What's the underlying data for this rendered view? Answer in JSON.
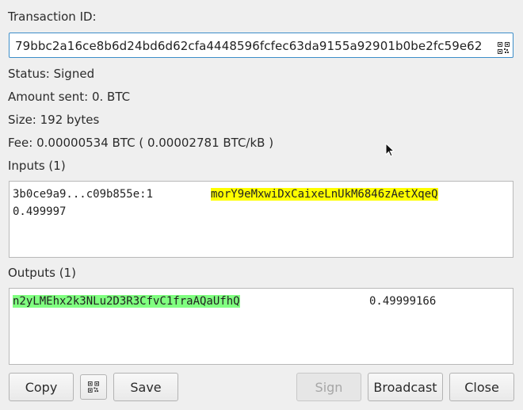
{
  "transaction": {
    "id_label": "Transaction ID:",
    "id_value": "79bbc2a16ce8b6d24bd6d62cfa4448596fcfec63da9155a92901b0be2fc59e62"
  },
  "details": {
    "status": "Status: Signed",
    "amount": "Amount sent: 0. BTC",
    "size": "Size: 192 bytes",
    "fee": "Fee: 0.00000534 BTC  ( 0.00002781 BTC/kB )"
  },
  "inputs": {
    "label": "Inputs (1)",
    "items": [
      {
        "outpoint": "3b0ce9a9...c09b855e:1",
        "address": "morY9eMxwiDxCaixeLnUkM6846zAetXqeQ",
        "amount": "0.499997",
        "highlight": "#ffff00"
      }
    ]
  },
  "outputs": {
    "label": "Outputs (1)",
    "items": [
      {
        "address": "n2yLMEhx2k3NLu2D3R3CfvC1fraAQaUfhQ",
        "amount": "0.49999166",
        "highlight": "#80ff80"
      }
    ]
  },
  "buttons": {
    "copy": "Copy",
    "qr_icon": "qr-code-icon",
    "save": "Save",
    "sign": "Sign",
    "broadcast": "Broadcast",
    "close": "Close"
  }
}
